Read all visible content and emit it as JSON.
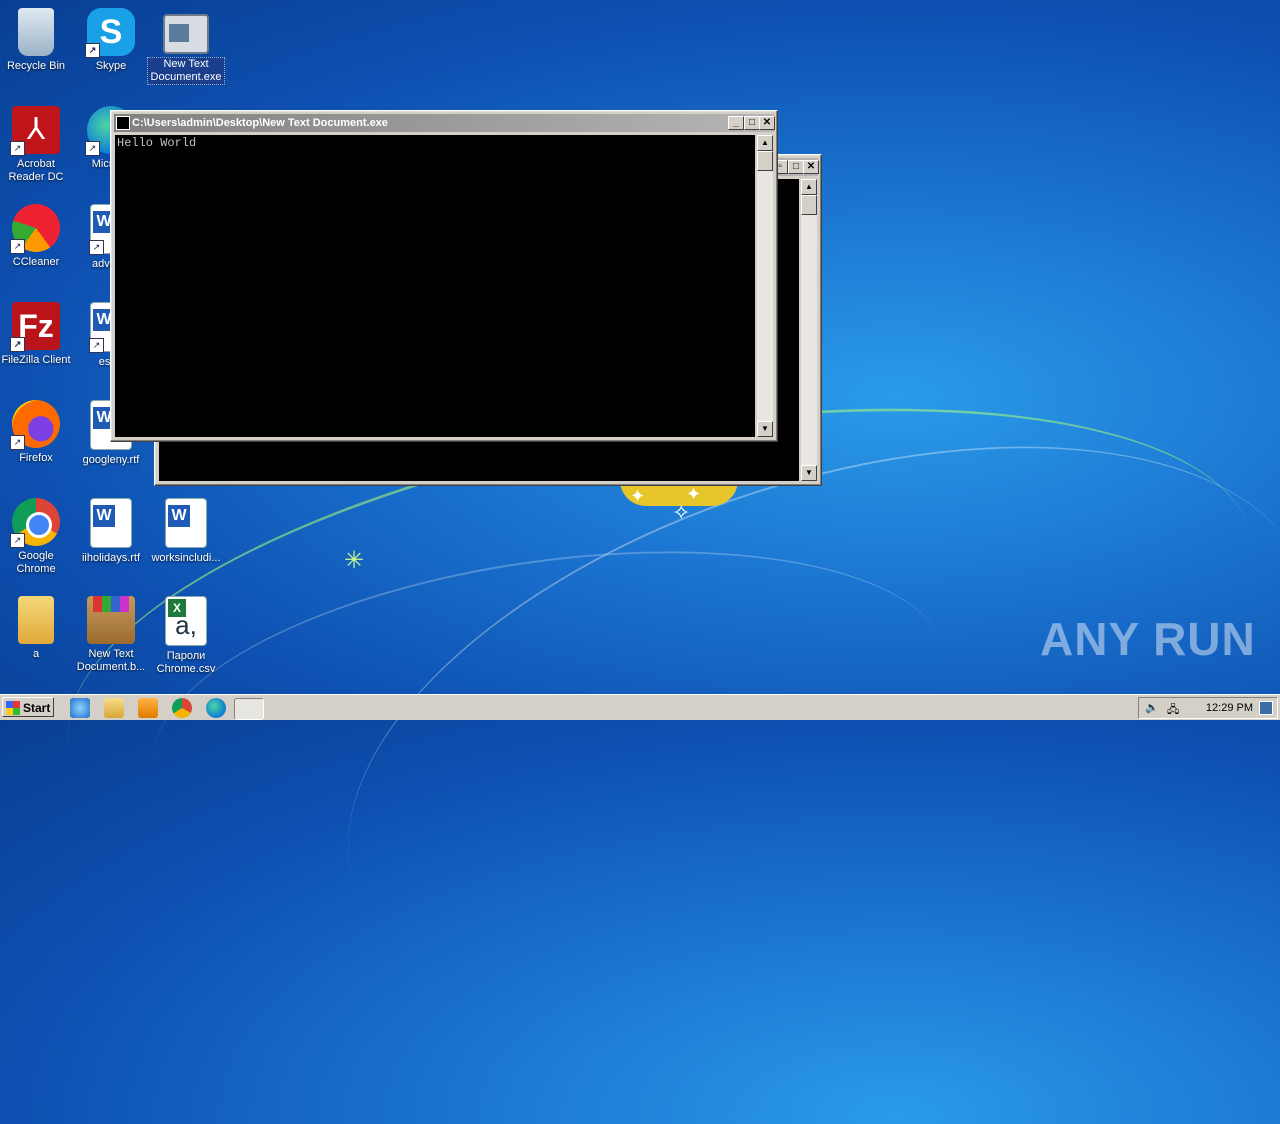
{
  "desktop": {
    "icons": [
      {
        "label": "Recycle Bin"
      },
      {
        "label": "Skype"
      },
      {
        "label": "New Text Document.exe"
      },
      {
        "label": "Acrobat Reader DC"
      },
      {
        "label": "Microso"
      },
      {
        "label": "CCleaner"
      },
      {
        "label": "adviced"
      },
      {
        "label": "FileZilla Client"
      },
      {
        "label": "estpr"
      },
      {
        "label": "Firefox"
      },
      {
        "label": "googleny.rtf"
      },
      {
        "label": "Google Chrome"
      },
      {
        "label": "iiholidays.rtf"
      },
      {
        "label": "worksincludi..."
      },
      {
        "label": "a"
      },
      {
        "label": "New Text Document.b..."
      },
      {
        "label": "Пароли Chrome.csv"
      }
    ],
    "watermark": "ANY RUN"
  },
  "console_front": {
    "title": "C:\\Users\\admin\\Desktop\\New Text Document.exe",
    "output": "Hello World"
  },
  "taskbar": {
    "start_label": "Start",
    "clock": "12:29 PM"
  },
  "colors": {
    "titlebar_inactive": "#808080",
    "console_bg": "#000000",
    "taskbar": "#d4d0c8"
  }
}
